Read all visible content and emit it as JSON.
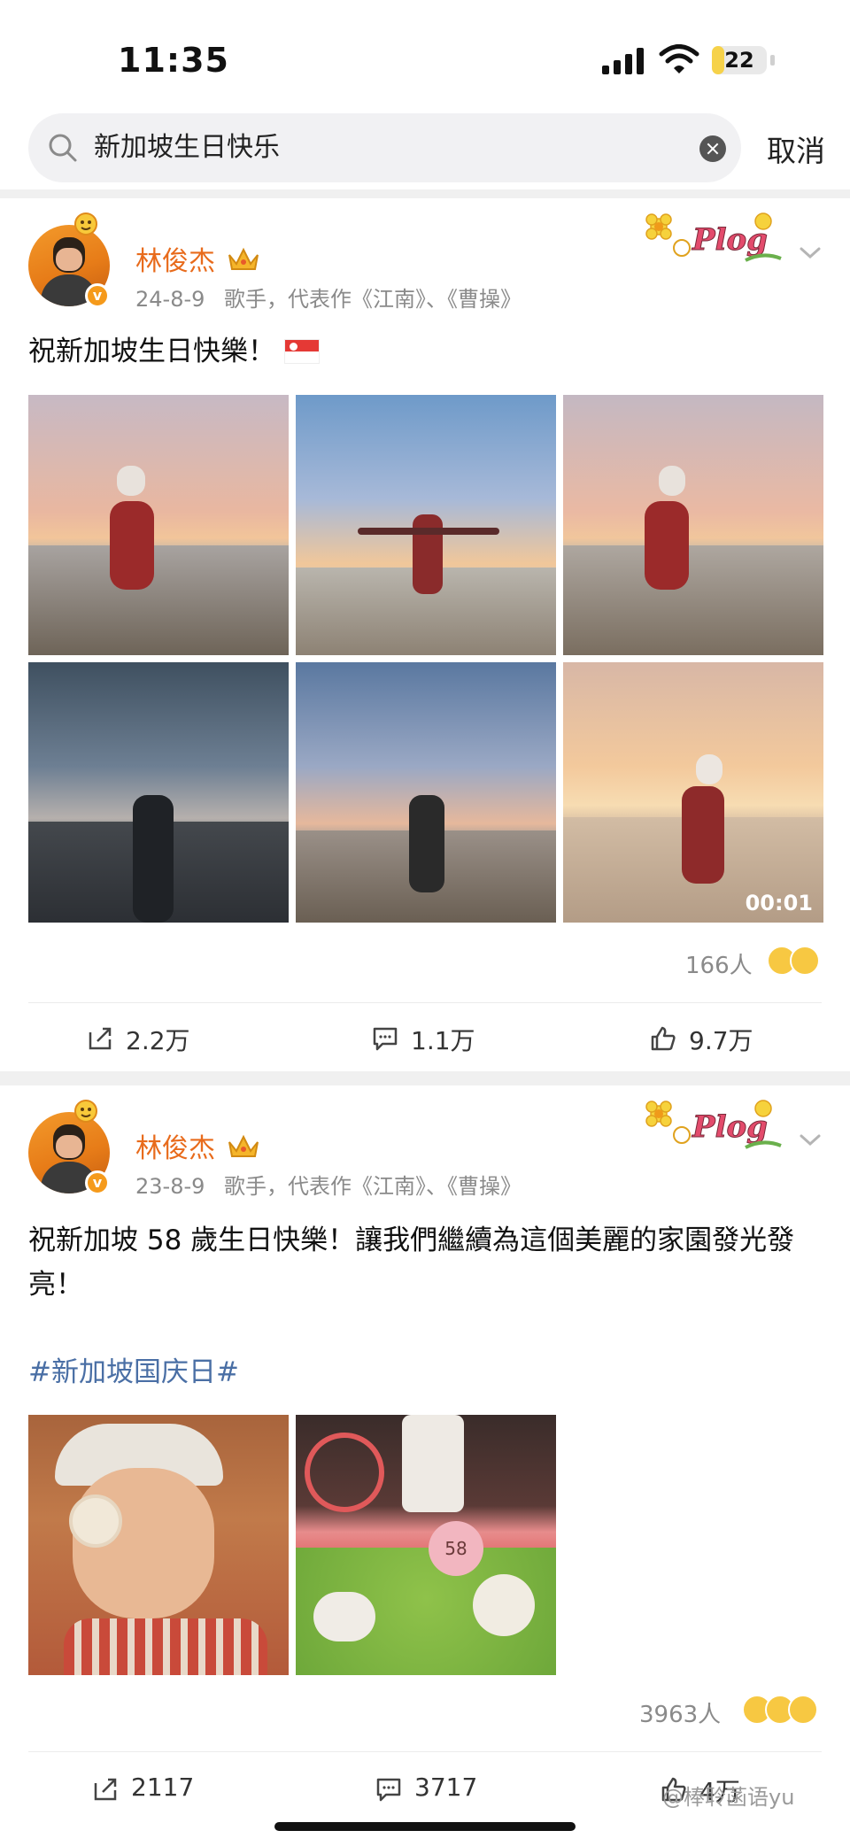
{
  "status_bar": {
    "time": "11:35",
    "battery": "22",
    "battery_level": 0.22
  },
  "search": {
    "query": "新加坡生日快乐",
    "cancel_label": "取消"
  },
  "posts": [
    {
      "username": "林俊杰",
      "date": "24-8-9",
      "bio": "歌手，代表作《江南》、《曹操》",
      "text": "祝新加坡生日快樂！",
      "video_duration": "00:01",
      "reaction_count": "166人",
      "shares": "2.2万",
      "comments": "1.1万",
      "likes": "9.7万"
    },
    {
      "username": "林俊杰",
      "date": "23-8-9",
      "bio": "歌手，代表作《江南》、《曹操》",
      "text": "祝新加坡 58 歲生日快樂！讓我們繼續為這個美麗的家園發光發亮！",
      "hashtag": "#新加坡国庆日#",
      "cake_number": "58",
      "reaction_count": "3963人",
      "shares": "2117",
      "comments": "3717",
      "likes": "4万"
    }
  ],
  "watermark": "@棒聆菡语yu",
  "colors": {
    "username": "#e86b1c",
    "hashtag": "#4a6fa5",
    "badge": "#f59a1b"
  }
}
